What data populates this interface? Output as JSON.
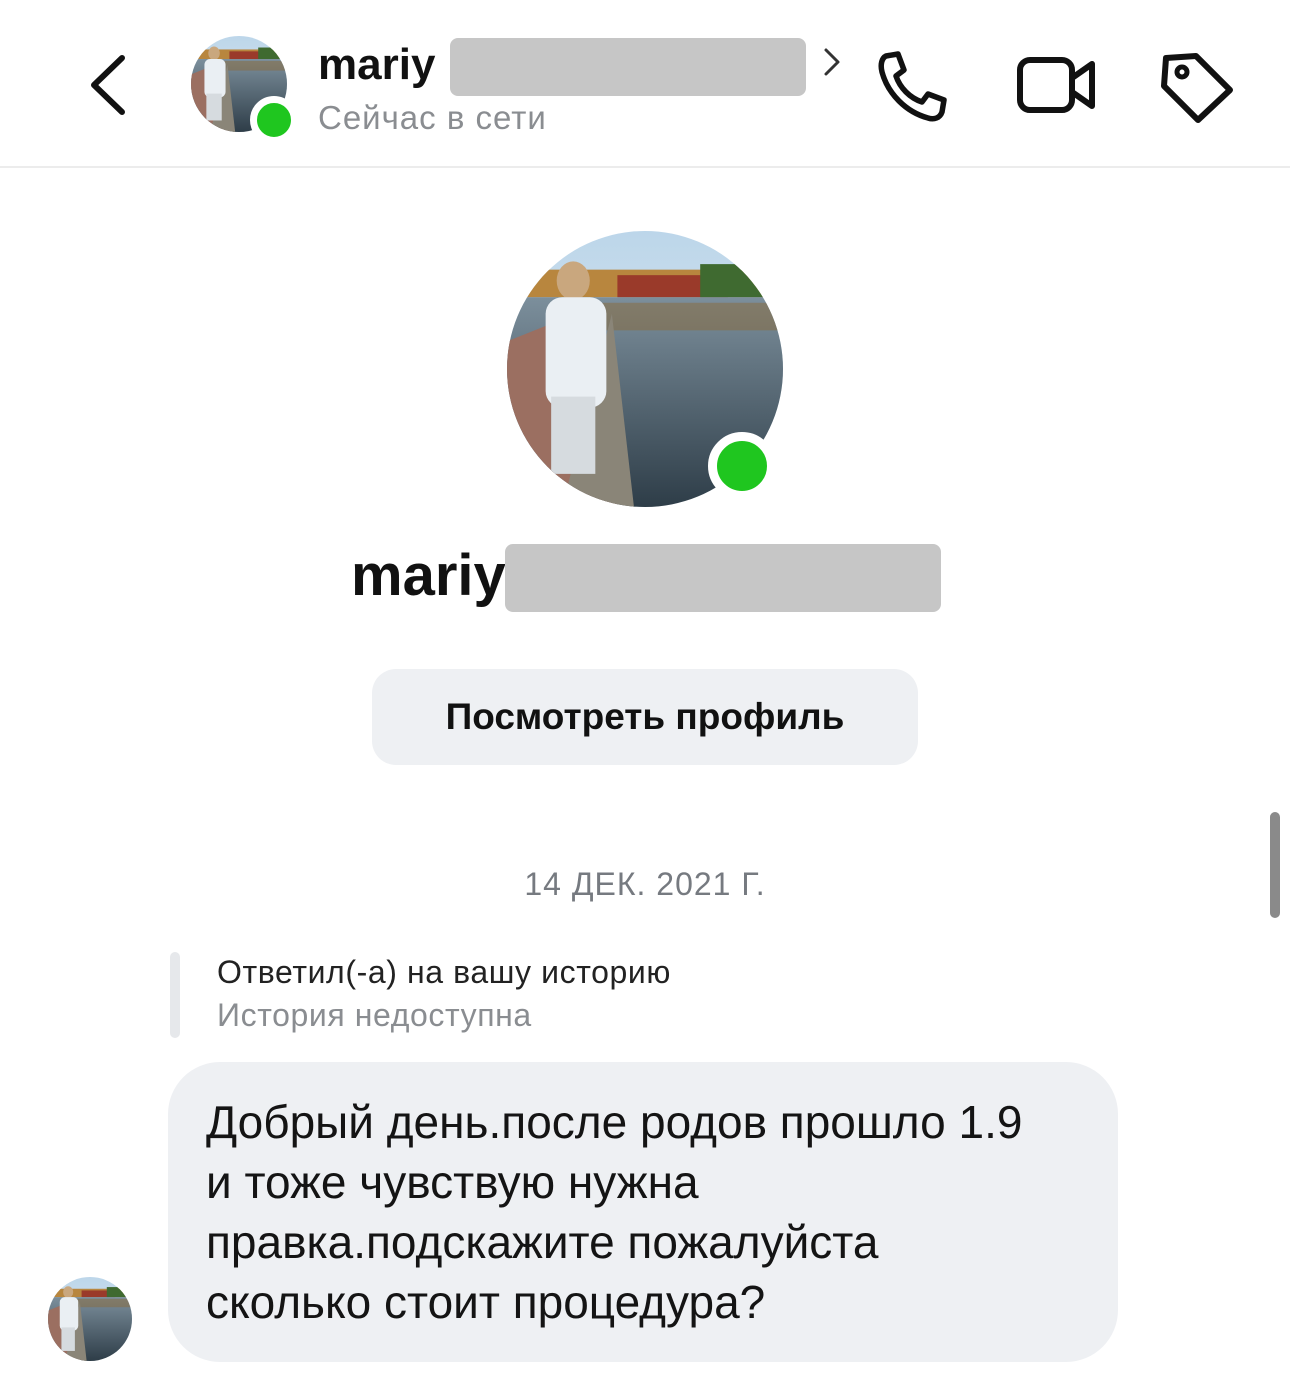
{
  "header": {
    "name_visible": "mariy",
    "status": "Сейчас в сети",
    "icons": [
      "back-chevron-icon",
      "chevron-right-icon",
      "phone-icon",
      "video-camera-icon",
      "tag-icon"
    ]
  },
  "profile": {
    "name_visible": "mariy",
    "view_profile_label": "Посмотреть профиль"
  },
  "chat": {
    "date": "14 ДЕК. 2021 Г.",
    "reply_title": "Ответил(-а) на вашу историю",
    "reply_subtitle": "История недоступна",
    "message_lines": [
      "Добрый день.после родов прошло 1.9",
      "и тоже чувствую нужна",
      "правка.подскажите пожалуйста",
      "сколько стоит процедура?"
    ]
  },
  "colors": {
    "online": "#1fc61f",
    "bubble": "#eef0f3",
    "muted_text": "#8a8d91",
    "redaction": "#c6c6c6"
  }
}
